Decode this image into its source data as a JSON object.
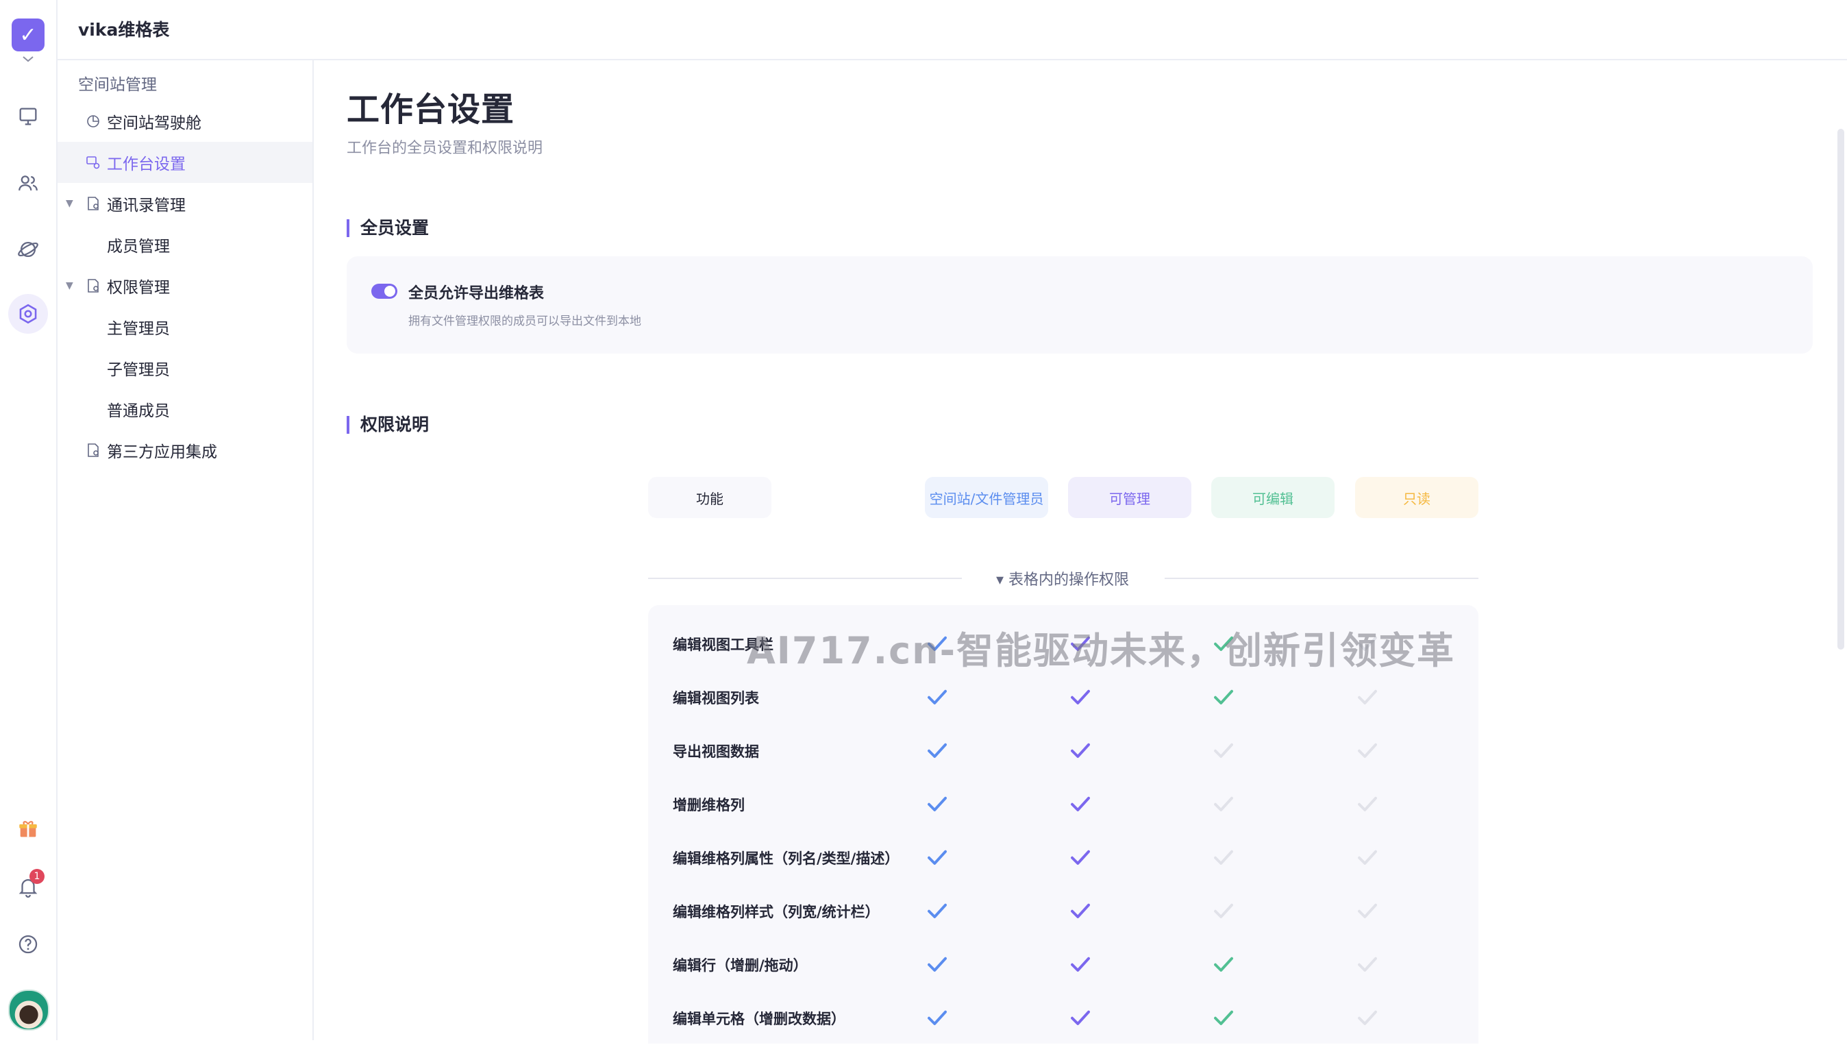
{
  "app": {
    "title": "vika维格表"
  },
  "rail": {
    "items": [
      {
        "name": "workbench-icon"
      },
      {
        "name": "contacts-icon"
      },
      {
        "name": "template-icon"
      },
      {
        "name": "space-settings-icon",
        "active": true
      }
    ],
    "bottom": [
      {
        "name": "gift-icon"
      },
      {
        "name": "notification-icon",
        "badge": "1"
      },
      {
        "name": "help-icon"
      }
    ]
  },
  "sidebar": {
    "section": "空间站管理",
    "items": [
      {
        "label": "空间站驾驶舱",
        "icon": "dashboard-icon"
      },
      {
        "label": "工作台设置",
        "icon": "workbench-settings-icon",
        "active": true
      },
      {
        "label": "通讯录管理",
        "icon": "contacts-manage-icon",
        "expandable": true
      },
      {
        "label": "成员管理"
      },
      {
        "label": "权限管理",
        "icon": "permission-icon",
        "expandable": true
      },
      {
        "label": "主管理员"
      },
      {
        "label": "子管理员"
      },
      {
        "label": "普通成员"
      },
      {
        "label": "第三方应用集成",
        "icon": "integration-icon"
      }
    ]
  },
  "main": {
    "title": "工作台设置",
    "description": "工作台的全员设置和权限说明",
    "all_settings": {
      "heading": "全员设置",
      "toggle_label": "全员允许导出维格表",
      "toggle_desc": "拥有文件管理权限的成员可以导出文件到本地",
      "toggle_on": true
    },
    "permissions": {
      "heading": "权限说明",
      "columns": [
        "功能",
        "空间站/文件管理员",
        "可管理",
        "可编辑",
        "只读"
      ],
      "column_colors": {
        "admin": "#5b8def",
        "manager": "#7b67ee",
        "editor": "#52c093",
        "reader": "#f5b942"
      },
      "group_title": "▾ 表格内的操作权限",
      "rows": [
        {
          "label": "编辑视图工具栏",
          "perms": [
            true,
            true,
            true,
            false
          ]
        },
        {
          "label": "编辑视图列表",
          "perms": [
            true,
            true,
            true,
            false
          ]
        },
        {
          "label": "导出视图数据",
          "perms": [
            true,
            true,
            false,
            false
          ]
        },
        {
          "label": "增删维格列",
          "perms": [
            true,
            true,
            false,
            false
          ]
        },
        {
          "label": "编辑维格列属性（列名/类型/描述）",
          "perms": [
            true,
            true,
            false,
            false
          ]
        },
        {
          "label": "编辑维格列样式（列宽/统计栏）",
          "perms": [
            true,
            true,
            false,
            false
          ]
        },
        {
          "label": "编辑行（增删/拖动）",
          "perms": [
            true,
            true,
            true,
            false
          ]
        },
        {
          "label": "编辑单元格（增删改数据）",
          "perms": [
            true,
            true,
            true,
            false
          ]
        }
      ]
    }
  },
  "watermark": "AI717.cn-智能驱动未来，创新引领变革"
}
